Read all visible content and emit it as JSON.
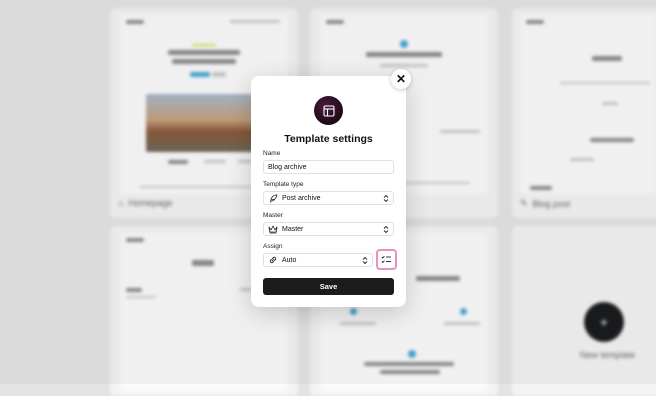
{
  "background": {
    "cards": [
      {
        "caption": "Homepage",
        "icon": "home-icon",
        "hero_text": "We design and make commerce websites"
      },
      {
        "caption": "",
        "icon": "",
        "hero_text": "Stories and interviews"
      },
      {
        "caption": "Blog post",
        "icon": "pen-icon",
        "hero_text": "Hello world!"
      },
      {
        "caption": "",
        "icon": "",
        "hero_text": "Blog"
      },
      {
        "caption": "",
        "icon": "",
        "hero_text": "this page"
      },
      {
        "caption": "New template",
        "icon": "plus-icon",
        "hero_text": ""
      }
    ]
  },
  "modal": {
    "title": "Template settings",
    "close_label": "✕",
    "fields": {
      "name": {
        "label": "Name",
        "value": "Blog archive"
      },
      "template_type": {
        "label": "Template type",
        "value": "Post archive",
        "icon": "feather-icon"
      },
      "master": {
        "label": "Master",
        "value": "Master",
        "icon": "crown-icon"
      },
      "assign": {
        "label": "Assign",
        "value": "Auto",
        "icon": "link-icon"
      }
    },
    "save_label": "Save",
    "colors": {
      "accent_border": "#ea8fbf",
      "save_bg": "#1b1c1e",
      "logo_bg": "#2a0f22"
    }
  }
}
